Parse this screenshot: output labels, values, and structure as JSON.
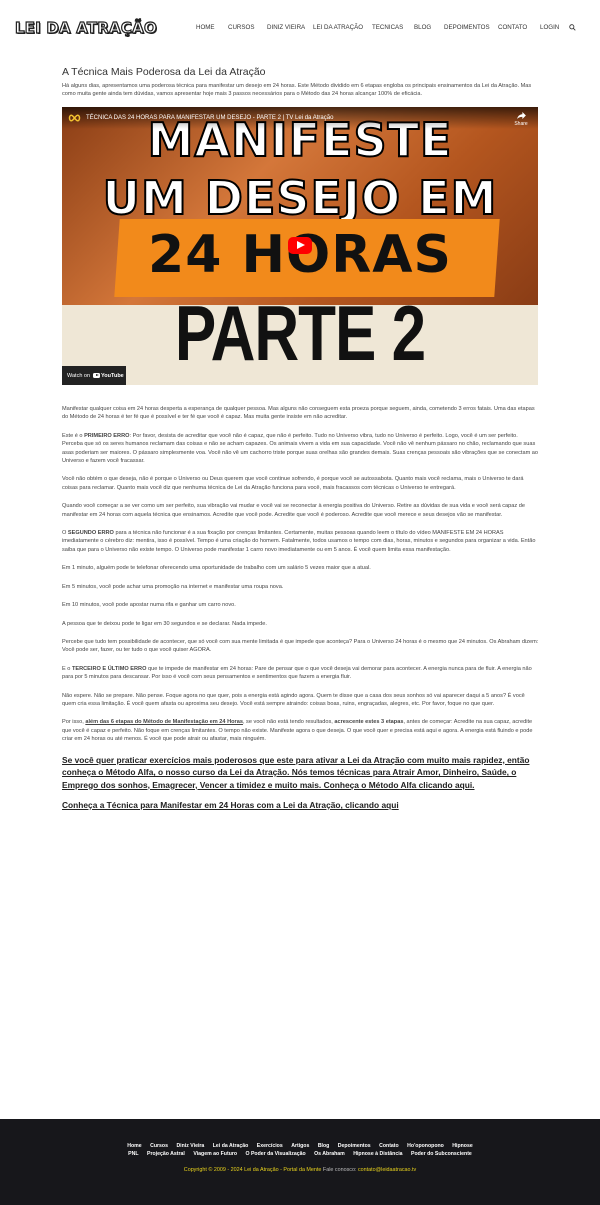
{
  "header": {
    "logo": "LEI DA ATRAÇÃO",
    "nav": [
      "HOME",
      "CURSOS",
      "DINIZ VIEIRA",
      "LEI DA ATRAÇÃO",
      "TECNICAS",
      "BLOG",
      "DEPOIMENTOS",
      "CONTATO",
      "LOGIN"
    ],
    "search_icon": "search-icon"
  },
  "article": {
    "title": "A Técnica Mais Poderosa da Lei da Atração",
    "intro": "Há alguns dias, apresentamos uma poderosa técnica para manifestar um desejo em 24 horas. Este Método dividido em 6 etapas engloba os principais ensinamentos da Lei da Atração. Mas como muita gente ainda tem dúvidas, vamos apresentar hoje mais 3 passos necessários para o Método das 24 horas alcançar 100% de eficácia."
  },
  "video": {
    "title": "TÉCNICA DAS 24 HORAS PARA MANIFESTAR UM DESEJO - PARTE 2 | TV Lei da Atração",
    "share": "Share",
    "line1": "MANIFESTE",
    "line2": "UM DESEJO EM",
    "line3": "24 HORAS",
    "line4": "PARTE 2",
    "watch_on": "Watch on",
    "youtube": "YouTube"
  },
  "body": {
    "p1": "Manifestar qualquer coisa em 24 horas desperta a esperança de qualquer pessoa. Mas alguns não conseguem esta proeza porque seguem, ainda, cometendo 3 erros fatais. Uma das etapas do Método de 24 horas é ter fé que é possível e ter fé que você é capaz. Mas muita gente insiste em não acreditar.",
    "p2_pre": "Este é o ",
    "p2_bold": "PRIMEIRO ERRO",
    "p2_post": ": Por favor, desista de acreditar que você não é capaz, que não é perfeito. Tudo no Universo vibra, tudo no Universo é perfeito. Logo, você é um ser perfeito. Perceba que só os seres humanos reclamam das coisas e não se acham capazes. Os animais vivem a vida em sua capacidade. Você não vê nenhum pássaro no chão, reclamando que suas asas poderiam ser maiores. O pássaro simplesmente voa. Você não vê um cachorro triste porque suas orelhas são grandes demais. Suas crenças pessoais são vibrações que se conectam ao Universo e fazem você fracassar.",
    "p3": "Você não obtém o que deseja, não é porque o Universo ou Deus querem que você continue sofrendo, é porque você se autossabota. Quanto mais você reclama, mais o Universo te dará coisas para reclamar. Quanto mais você diz que nenhuma técnica de Lei da Atração funciona para você, mais fracassos com técnicas o Universo te entregará.",
    "p4": "Quando você começar a se ver como um ser perfeito, sua vibração vai mudar e você vai se reconectar à energia positiva do Universo. Retire as dúvidas de sua vida e você será capaz de manifestar em 24 horas com aquela técnica que ensinamos. Acredite que você pode. Acredite que você é poderoso. Acredite que você merece e seus desejos vão se manifestar.",
    "p5_pre": "O ",
    "p5_bold": "SEGUNDO ERRO",
    "p5_post": " para a técnica não funcionar é a sua fixação por crenças limitantes. Certamente, muitas pessoas quando leem o título do vídeo MANIFESTE EM 24 HORAS imediatamente o cérebro diz: mentira, isso é possível. Tempo é uma criação do homem. Fatalmente, todos usamos o tempo com dias, horas, minutos e segundos para organizar a vida. Então saiba que para o Universo não existe tempo. O Universo pode manifestar 1 carro novo imediatamente ou em 5 anos. É você quem limita essa manifestação.",
    "p6": "Em 1 minuto, alguém pode te telefonar oferecendo uma oportunidade de trabalho com um salário 5 vezes maior que a atual.",
    "p7": "Em 5 minutos, você pode achar uma promoção na internet e manifestar uma roupa nova.",
    "p8": "Em 10 minutos, você pode apostar numa rifa e ganhar um carro novo.",
    "p9": "A pessoa que te deixou pode te ligar em 30 segundos e se declarar. Nada impede.",
    "p10": "Percebe que tudo tem possibilidade de acontecer, que só você com sua mente limitada é que impede que aconteça? Para o Universo 24 horas é o mesmo que 24 minutos. Os Abraham dizem: Você pode ser, fazer, ou ter tudo o que você quiser AGORA.",
    "p11_pre": "E o ",
    "p11_bold": "TERCEIRO E ÚLTIMO ERRO",
    "p11_post": " que te impede de manifestar em 24 horas: Pare de pensar que o que você deseja vai demorar para acontecer. A energia nunca para de fluir. A energia não para por 5 minutos para descansar. Por isso é você com seus pensamentos e sentimentos que fazem a energia fluir.",
    "p12": "Não espere. Não se prepare. Não pense. Foque agora no que quer, pois a energia está agindo agora. Quem te disse que a casa dos seus sonhos só vai aparecer daqui a 5 anos? É você quem cria essa limitação. É você quem afasta ou aproxima seu desejo. Você está sempre atraindo: coisas boas, ruins, engraçadas, alegres, etc. Por favor, foque no que quer.",
    "p13_pre": "Por isso, ",
    "p13_link": "além das 6 etapas do Método de Manifestação em 24 Horas",
    "p13_mid": ", se você não está tendo resultados, ",
    "p13_bold": "acrescente estes 3 etapas",
    "p13_post": ", antes de começar: Acredite na sua capaz, acredite que você é capaz e perfeito. Não foque em crenças limitantes. O tempo não existe. Manifeste agora o que deseja. O que você quer e precisa está aqui e agora. A energia está fluindo e pode criar em 24 horas ou até menos. É você que pode atrair ou afastar, mais ninguém.",
    "cta1": "Se você quer praticar exercícios mais poderosos que este para ativar a Lei da Atração com muito mais rapidez, então conheça o Método Alfa, o nosso curso da Lei da Atração. Nós temos técnicas para Atrair Amor, Dinheiro, Saúde, o Emprego dos sonhos, Emagrecer, Vencer a timidez e muito mais. Conheça o Método Alfa clicando aqui.",
    "cta2": "Conheça a Técnica para Manifestar em 24 Horas com a Lei da Atração, clicando aqui"
  },
  "footer": {
    "row1": [
      "Home",
      "Cursos",
      "Diniz Vieira",
      "Lei da Atração",
      "Exercícios",
      "Artigos",
      "Blog",
      "Depoimentos",
      "Contato",
      "Ho'oponopono",
      "Hipnose"
    ],
    "row2": [
      "PNL",
      "Projeção Astral",
      "Viagem ao Futuro",
      "O Poder da Visualização",
      "Os Abraham",
      "Hipnose à Distância",
      "Poder do Subconsciente"
    ],
    "copyright": "Copyright © 2009 - 2024 Lei da Atração - Portal da Mente",
    "contact_label": "Fale conosco:",
    "email": "contato@leidaatracao.tv",
    "accent": "#e8d21d"
  }
}
